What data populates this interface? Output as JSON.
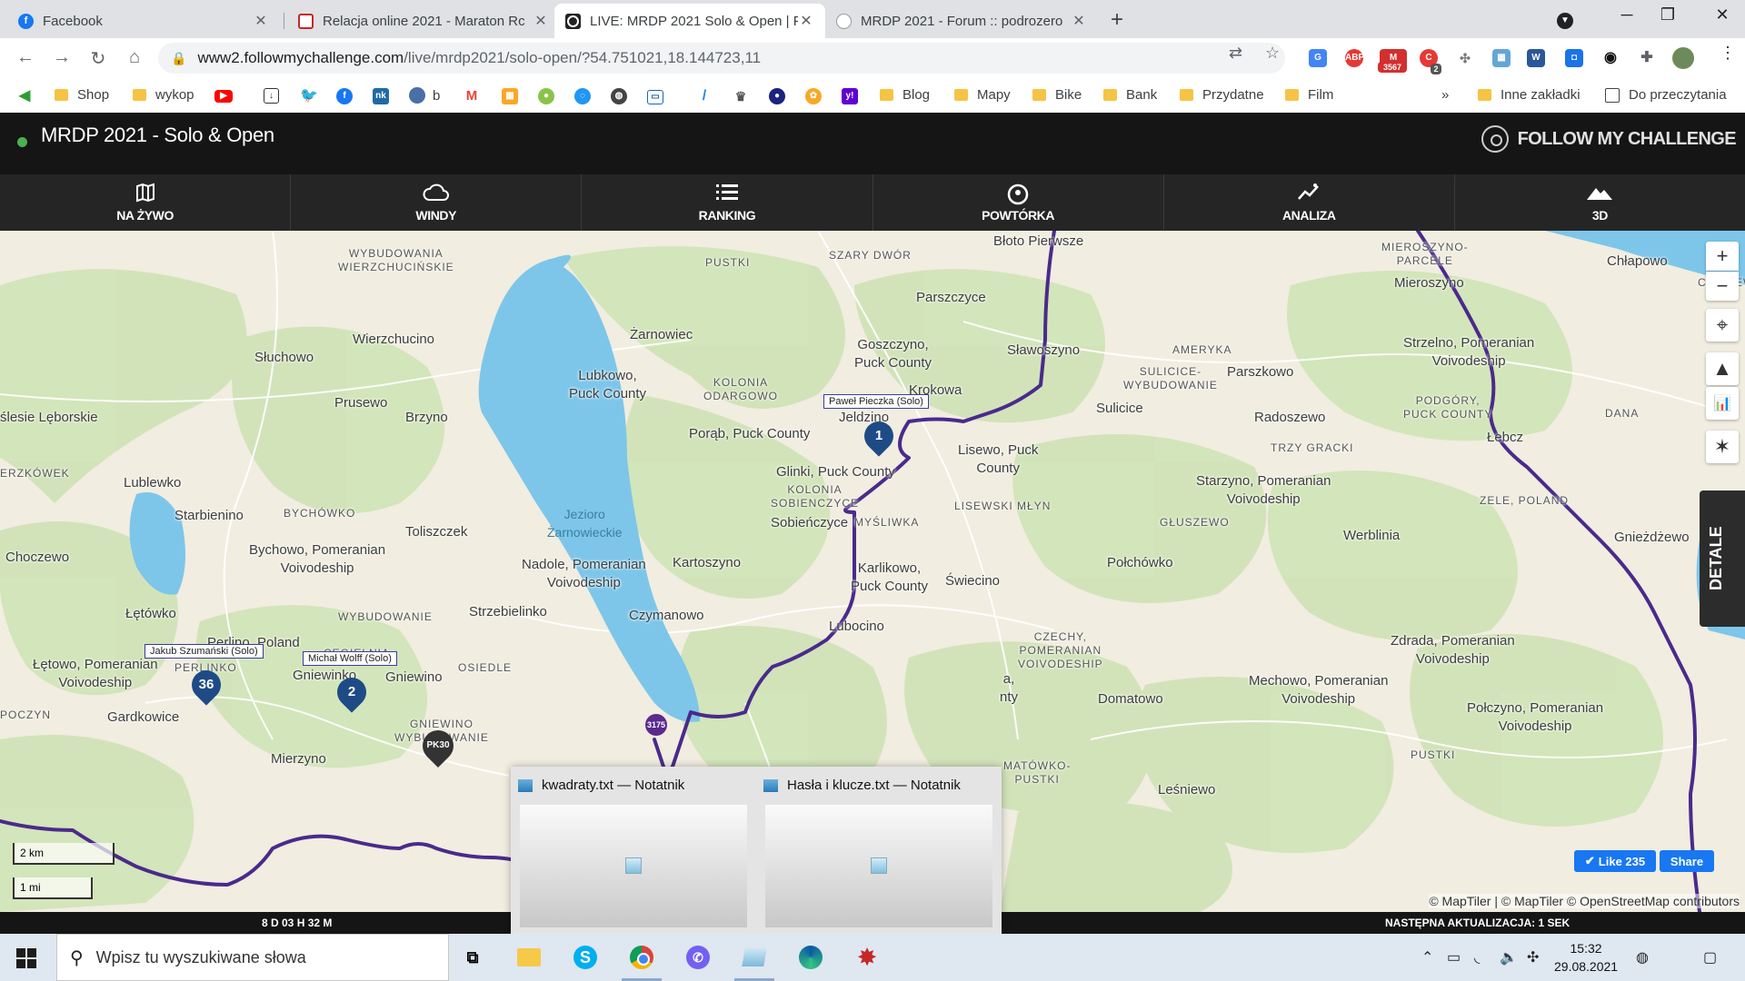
{
  "browser": {
    "tabs": [
      {
        "title": "Facebook",
        "icon": "facebook-icon",
        "color": "#1877f2",
        "glyph": "f",
        "active": false
      },
      {
        "title": "Relacja online 2021 - Maraton Rc",
        "icon": "maraton-icon",
        "color": "#c62828",
        "glyph": "",
        "active": false
      },
      {
        "title": "LIVE: MRDP 2021 Solo & Open | F",
        "icon": "fmc-icon",
        "color": "#222222",
        "glyph": "",
        "active": true
      },
      {
        "title": "MRDP 2021 - Forum :: podrozero",
        "icon": "forum-icon",
        "color": "#9e9e9e",
        "glyph": "",
        "active": false
      }
    ],
    "url_host": "www2.followmychallenge.com",
    "url_path": "/live/mrdp2021/solo-open/?54.751021,18.144723,11",
    "bookmarks": [
      {
        "label": "Shop",
        "type": "folder"
      },
      {
        "label": "wykop",
        "type": "folder"
      },
      {
        "label": "b",
        "type": "site"
      },
      {
        "label": "Blog",
        "type": "folder"
      },
      {
        "label": "Mapy",
        "type": "folder"
      },
      {
        "label": "Bike",
        "type": "folder"
      },
      {
        "label": "Bank",
        "type": "folder"
      },
      {
        "label": "Przydatne",
        "type": "folder"
      },
      {
        "label": "Film",
        "type": "folder"
      },
      {
        "label": "Inne zakładki",
        "type": "folder"
      },
      {
        "label": "Do przeczytania",
        "type": "list"
      }
    ],
    "overflow": "»",
    "extension_badges": {
      "gmail": "3567",
      "other": "2"
    }
  },
  "app": {
    "title": "MRDP 2021 - Solo & Open",
    "brand": "FOLLOW MY CHALLENGE",
    "status_color": "#4caf50",
    "nav": [
      {
        "label": "NA ŻYWO",
        "icon": "map-icon",
        "glyph": "▯"
      },
      {
        "label": "WINDY",
        "icon": "cloud-icon",
        "glyph": "☁"
      },
      {
        "label": "RANKING",
        "icon": "list-icon",
        "glyph": "☰"
      },
      {
        "label": "POWTÓRKA",
        "icon": "replay-icon",
        "glyph": "◎"
      },
      {
        "label": "ANALIZA",
        "icon": "analysis-icon",
        "glyph": "✦"
      },
      {
        "label": "3D",
        "icon": "mountain-icon",
        "glyph": "▲"
      }
    ],
    "detail_tab": "DETALE",
    "elapsed": "8 D 03 H 32 M",
    "next_update": "NASTĘPNA AKTUALIZACJA: 1 SEK"
  },
  "map": {
    "places": [
      {
        "text": "Błoto Pierwsze",
        "small": false
      },
      {
        "text": "WYBUDOWANIA\nWIERZCHUCIŃSKIE",
        "small": true
      },
      {
        "text": "PUSTKI",
        "small": true
      },
      {
        "text": "SZARY DWÓR",
        "small": true
      },
      {
        "text": "MIEROSZYNO-\nPARCELE",
        "small": true
      },
      {
        "text": "Chłapowo",
        "small": false
      },
      {
        "text": "Mieroszyno",
        "small": false
      },
      {
        "text": "CETNIEWO",
        "small": true
      },
      {
        "text": "Parszczyce",
        "small": false
      },
      {
        "text": "Wierzchucino",
        "small": false
      },
      {
        "text": "Żarnowiec",
        "small": false
      },
      {
        "text": "Goszczyno,\nPuck County",
        "small": false
      },
      {
        "text": "Sławoszyno",
        "small": false
      },
      {
        "text": "AMERYKA",
        "small": true
      },
      {
        "text": "Strzelno, Pomeranian\nVoivodeship",
        "small": false
      },
      {
        "text": "Słuchowo",
        "small": false
      },
      {
        "text": "Lubkowo,\nPuck County",
        "small": false
      },
      {
        "text": "KOLONIA\nODARGOWO",
        "small": true
      },
      {
        "text": "Krokowa",
        "small": false
      },
      {
        "text": "SULICICE-\nWYBUDOWANIE",
        "small": true
      },
      {
        "text": "Parszkowo",
        "small": false
      },
      {
        "text": "Prusewo",
        "small": false
      },
      {
        "text": "Brzyno",
        "small": false
      },
      {
        "text": "Jeldzino",
        "small": false
      },
      {
        "text": "Sulicice",
        "small": false
      },
      {
        "text": "Radoszewo",
        "small": false
      },
      {
        "text": "PODGÓRY,\nPUCK COUNTY",
        "small": true
      },
      {
        "text": "DANA",
        "small": true
      },
      {
        "text": "ślesie Lęborskie",
        "small": false
      },
      {
        "text": "Porąb, Puck County",
        "small": false
      },
      {
        "text": "TRZY GRACKI",
        "small": true
      },
      {
        "text": "Łebcz",
        "small": false
      },
      {
        "text": "Lisewo, Puck\nCounty",
        "small": false
      },
      {
        "text": "Jezioro\nŻarnowieckie",
        "small": false,
        "lake": true
      },
      {
        "text": "ERZKÓWEK",
        "small": true
      },
      {
        "text": "Glinki, Puck County",
        "small": false
      },
      {
        "text": "Starzyno, Pomeranian\nVoivodeship",
        "small": false
      },
      {
        "text": "Lublewko",
        "small": false
      },
      {
        "text": "KOLONIA\nSOBIENCZYCE",
        "small": true
      },
      {
        "text": "ZELE, POLAND",
        "small": true
      },
      {
        "text": "Starbienino",
        "small": false
      },
      {
        "text": "BYCHÓWKO",
        "small": true
      },
      {
        "text": "Sobieńczyce",
        "small": false
      },
      {
        "text": "MYŚLIWKA",
        "small": true
      },
      {
        "text": "LISEWSKI MŁYN",
        "small": true
      },
      {
        "text": "GŁUSZEWO",
        "small": true
      },
      {
        "text": "Toliszczek",
        "small": false
      },
      {
        "text": "Werblinia",
        "small": false
      },
      {
        "text": "Gnieżdżewo",
        "small": false
      },
      {
        "text": "Choczewo",
        "small": false
      },
      {
        "text": "Bychowo, Pomeranian\nVoivodeship",
        "small": false
      },
      {
        "text": "Nadole, Pomeranian\nVoivodeship",
        "small": false
      },
      {
        "text": "Kartoszyno",
        "small": false
      },
      {
        "text": "Karlikowo,\nPuck County",
        "small": false
      },
      {
        "text": "Świecino",
        "small": false
      },
      {
        "text": "Połchówko",
        "small": false
      },
      {
        "text": "Łętówko",
        "small": false
      },
      {
        "text": "WYBUDOWANIE",
        "small": true
      },
      {
        "text": "Strzebielinko",
        "small": false
      },
      {
        "text": "Czymanowo",
        "small": false
      },
      {
        "text": "Lubocino",
        "small": false
      },
      {
        "text": "Perlino, Poland",
        "small": false
      },
      {
        "text": "CZECHY,\nPOMERANIAN\nVOIVODESHIP",
        "small": true
      },
      {
        "text": "Zdrada, Pomeranian\nVoivodeship",
        "small": false
      },
      {
        "text": "Łętowo, Pomeranian\nVoivodeship",
        "small": false
      },
      {
        "text": "PERLINKO",
        "small": true
      },
      {
        "text": "CEGIELNIA",
        "small": true
      },
      {
        "text": "Gniewinko",
        "small": false
      },
      {
        "text": "Gniewino",
        "small": false
      },
      {
        "text": "OSIEDLE",
        "small": true
      },
      {
        "text": "Mechowo, Pomeranian\nVoivodeship",
        "small": false
      },
      {
        "text": "Gardkowice",
        "small": false
      },
      {
        "text": "POCZYN",
        "small": true
      },
      {
        "text": "GNIEWINO\nWYBUDOWANIE",
        "small": true
      },
      {
        "text": "Domatowo",
        "small": false
      },
      {
        "text": "Połczyno, Pomeranian\nVoivodeship",
        "small": false
      },
      {
        "text": "Mierzyno",
        "small": false
      },
      {
        "text": "PUSTKI",
        "small": true
      },
      {
        "text": "MATÓWKO-\nPUSTKI",
        "small": true
      },
      {
        "text": "Leśniewo",
        "small": false
      },
      {
        "text": "a,\nnty",
        "small": false
      }
    ],
    "riders": [
      {
        "label": "Paweł Pieczka (Solo)",
        "number": "1",
        "color": "#1e4b86"
      },
      {
        "label": "Jakub Szumański (Solo)",
        "number": "36",
        "color": "#1e4b86"
      },
      {
        "label": "Michał Wolff (Solo)",
        "number": "2",
        "color": "#1e4b86"
      }
    ],
    "checkpoint": {
      "label": "PK30",
      "color": "#333333"
    },
    "marker_other": {
      "label": "3175",
      "color": "#5b2a8c"
    },
    "route_color": "#4a2a8c",
    "scale": [
      "2 km",
      "1 mi"
    ],
    "attribution": "© MapTiler | © MapTiler © OpenStreetMap contributors",
    "like_label": "Like 235",
    "share_label": "Share",
    "controls": [
      {
        "glyph": "+",
        "icon": "zoom-in-icon"
      },
      {
        "glyph": "−",
        "icon": "zoom-out-icon"
      },
      {
        "glyph": "⌖",
        "icon": "locate-icon"
      },
      {
        "glyph": "▲",
        "icon": "terrain-icon"
      },
      {
        "glyph": "📊",
        "icon": "elevation-chart-icon"
      },
      {
        "glyph": "✶",
        "icon": "weather-toggle-icon"
      }
    ]
  },
  "taskbar": {
    "search_placeholder": "Wpisz tu wyszukiwane słowa",
    "time": "15:32",
    "date": "29.08.2021",
    "preview_windows": [
      {
        "title": "kwadraty.txt — Notatnik"
      },
      {
        "title": "Hasła i klucze.txt — Notatnik"
      }
    ]
  }
}
